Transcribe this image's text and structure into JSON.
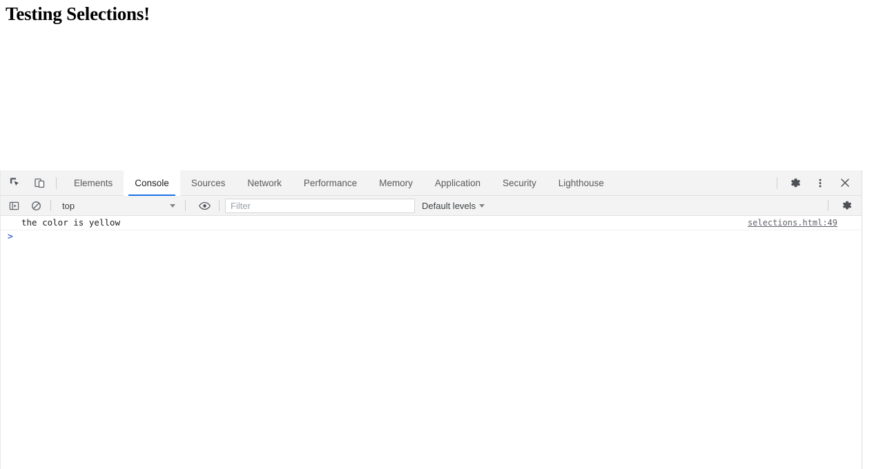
{
  "page": {
    "heading": "Testing Selections!"
  },
  "devtools": {
    "toolbar": {
      "inspect_icon": "inspect-element-icon",
      "device_icon": "device-toolbar-icon",
      "tabs": [
        {
          "label": "Elements",
          "active": false
        },
        {
          "label": "Console",
          "active": true
        },
        {
          "label": "Sources",
          "active": false
        },
        {
          "label": "Network",
          "active": false
        },
        {
          "label": "Performance",
          "active": false
        },
        {
          "label": "Memory",
          "active": false
        },
        {
          "label": "Application",
          "active": false
        },
        {
          "label": "Security",
          "active": false
        },
        {
          "label": "Lighthouse",
          "active": false
        }
      ],
      "settings_icon": "gear-icon",
      "more_icon": "kebab-menu-icon",
      "close_icon": "close-icon"
    },
    "console_toolbar": {
      "sidebar_toggle_icon": "console-sidebar-icon",
      "clear_icon": "clear-console-icon",
      "context": "top",
      "eye_icon": "live-expression-icon",
      "filter_placeholder": "Filter",
      "filter_value": "",
      "levels": "Default levels",
      "settings_icon": "gear-icon"
    },
    "console": {
      "messages": [
        {
          "text": "the color is yellow",
          "source": "selections.html:49"
        }
      ],
      "prompt_symbol": ">"
    }
  },
  "colors": {
    "accent": "#1a73e8",
    "toolbar_bg": "#f3f3f3",
    "prompt": "#4a6ee0",
    "text": "#202124",
    "muted": "#5f6368"
  }
}
